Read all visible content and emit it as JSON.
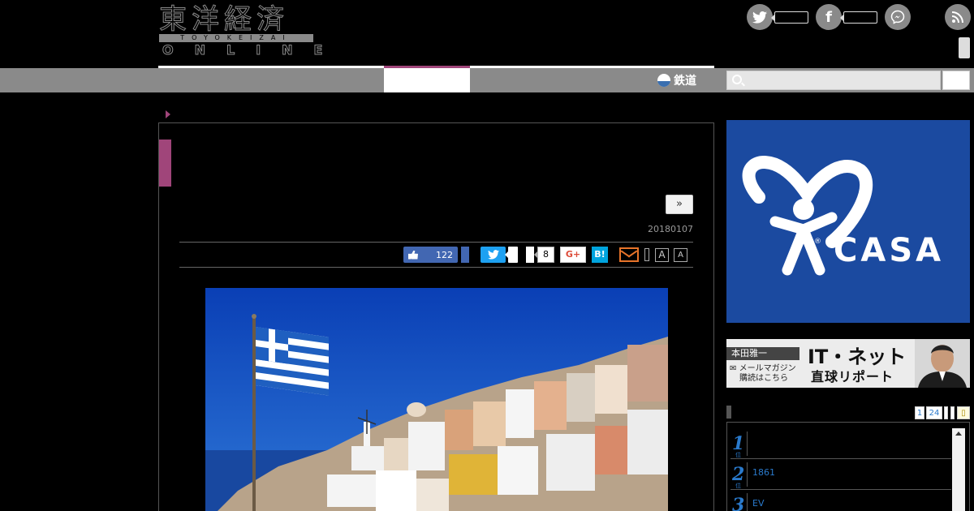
{
  "header": {
    "logo": {
      "kanji": "東洋経済",
      "roman": "TOYOKEIZAI",
      "online": "ONLINE"
    },
    "social_icons": [
      "twitter-icon",
      "facebook-icon",
      "messenger-icon",
      "rss-icon"
    ]
  },
  "nav": {
    "rail_label": "鉄道",
    "search": {
      "placeholder": ""
    }
  },
  "article": {
    "next_label": "»",
    "date": "20180107",
    "share": {
      "facebook_like_count": "122",
      "hatena_count": "8",
      "gplus_label": "G+",
      "hatebu_label": "B!",
      "font_size_labels": [
        "A",
        "A"
      ]
    }
  },
  "sidebar": {
    "ad_brand": "CASA",
    "banner": {
      "name": "本田雅一",
      "subtitle_line1": "メールマガジン",
      "subtitle_line2": "購読はこちら",
      "title_line1": "IT・ネット",
      "title_line2": "直球リポート"
    },
    "ranking": {
      "tabs": [
        "1",
        "24"
      ],
      "items": [
        {
          "rank": "1",
          "unit": "位",
          "text": ""
        },
        {
          "rank": "2",
          "unit": "位",
          "text": "1861"
        },
        {
          "rank": "3",
          "unit": "位",
          "text": "EV"
        }
      ]
    }
  },
  "colors": {
    "accent": "#a0457a",
    "nav_gray": "#8a8a8a",
    "link_blue": "#2a7acc",
    "facebook": "#4267b2",
    "twitter": "#1da1f2",
    "hatena": "#00a4de"
  }
}
